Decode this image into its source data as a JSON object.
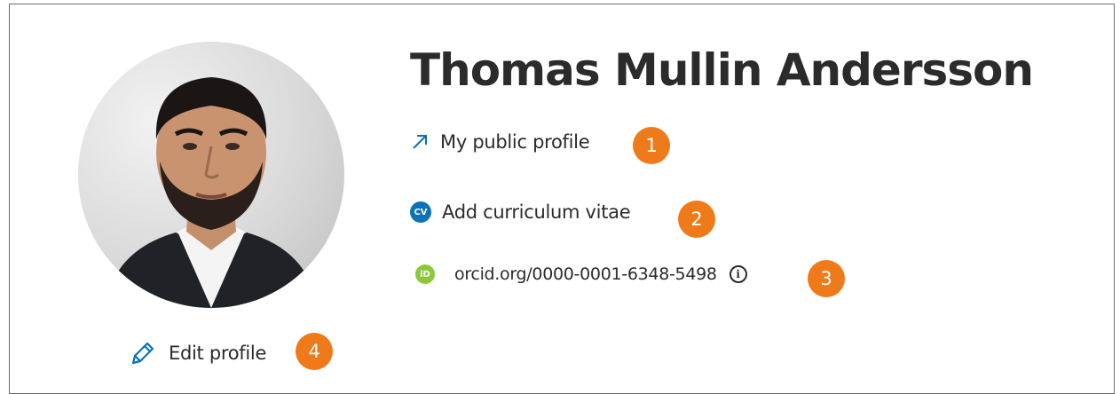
{
  "profile": {
    "name": "Thomas Mullin Andersson",
    "avatar_icon": "person-photo-icon",
    "public_profile_label": "My public profile",
    "public_profile_icon": "arrow-up-right-icon",
    "add_cv_label": "Add curriculum vitae",
    "cv_icon_text": "CV",
    "orcid_label": "orcid.org/0000-0001-6348-5498",
    "orcid_icon_text": "iD",
    "info_icon_text": "i",
    "edit_profile_label": "Edit profile",
    "edit_icon": "pencil-icon"
  },
  "callouts": {
    "one": "1",
    "two": "2",
    "three": "3",
    "four": "4",
    "color": "#ef7a1a"
  },
  "colors": {
    "accent": "#0a72b8",
    "orcid": "#8cc83b",
    "text": "#2b2b2b",
    "border": "#6b6b6b"
  }
}
